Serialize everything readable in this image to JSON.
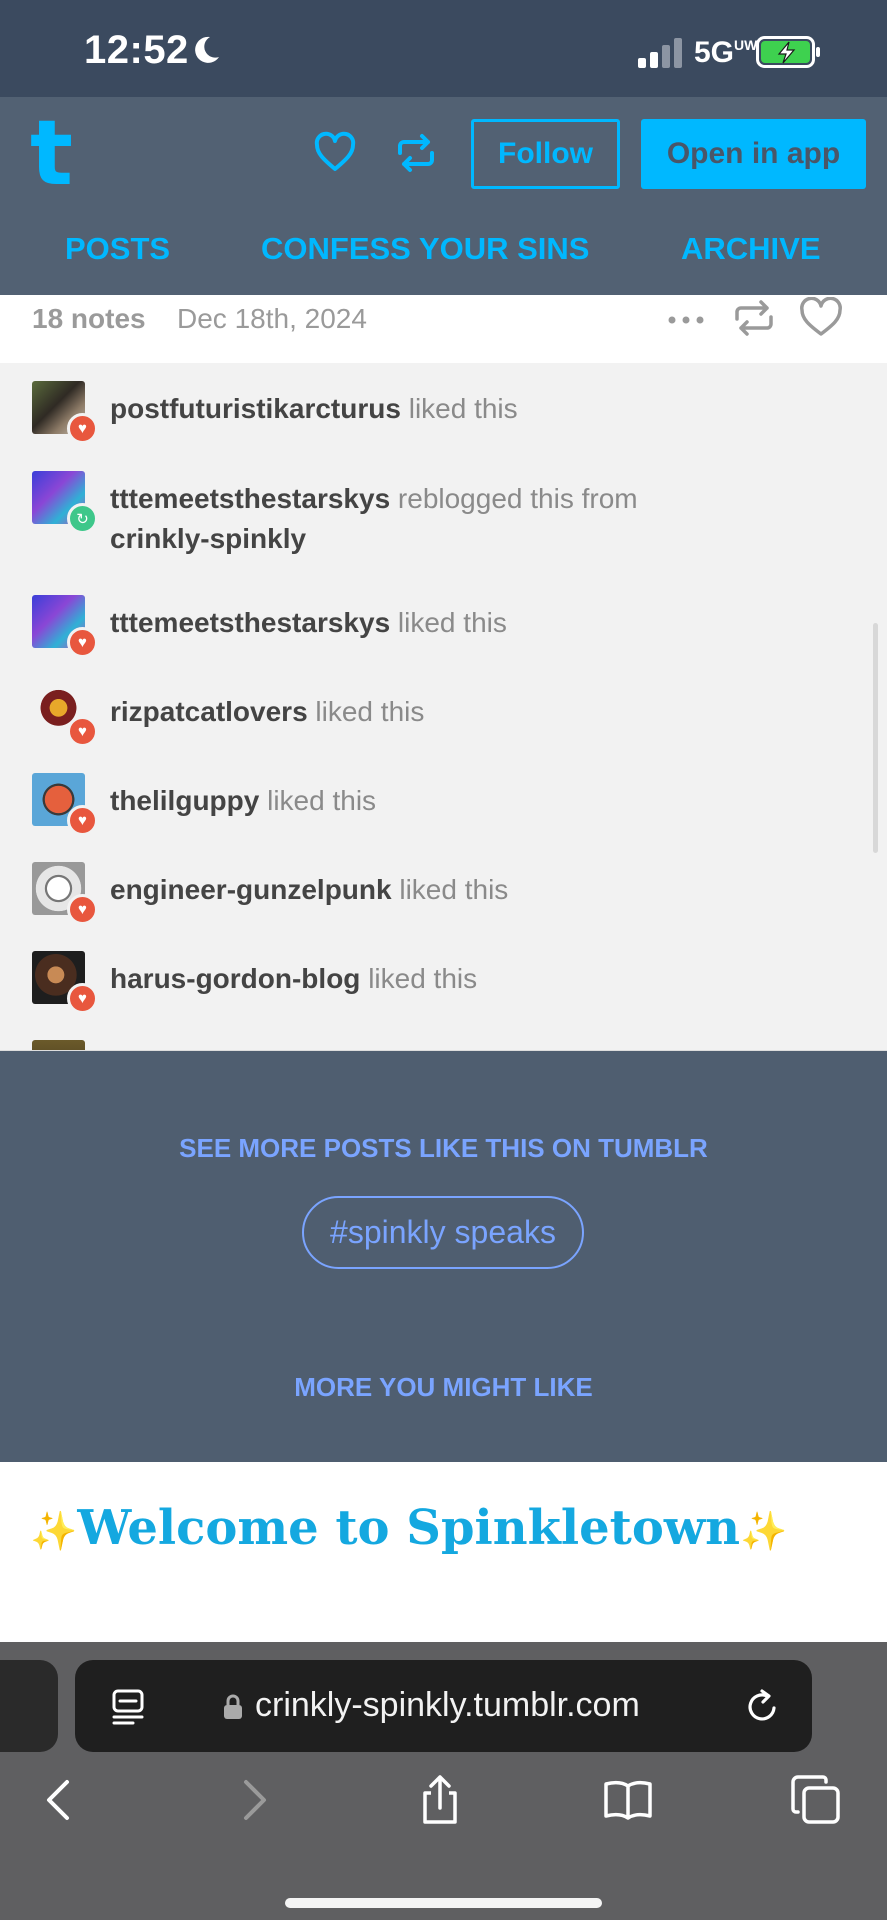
{
  "status_bar": {
    "time": "12:52",
    "network": "5G",
    "network_suffix": "UW"
  },
  "header": {
    "logo": "t",
    "follow_label": "Follow",
    "open_app_label": "Open in app",
    "tabs": [
      "POSTS",
      "CONFESS YOUR SINS",
      "ARCHIVE"
    ]
  },
  "post_meta": {
    "notes": "18 notes",
    "date": "Dec 18th, 2024"
  },
  "notes": [
    {
      "user": "postfuturistikarcturus",
      "action": "liked this",
      "type": "like"
    },
    {
      "user": "tttemeetsthestarskys",
      "action": "reblogged this from",
      "from": "crinkly-spinkly",
      "type": "reblog"
    },
    {
      "user": "tttemeetsthestarskys",
      "action": "liked this",
      "type": "like"
    },
    {
      "user": "rizpatcatlovers",
      "action": "liked this",
      "type": "like"
    },
    {
      "user": "thelilguppy",
      "action": "liked this",
      "type": "like"
    },
    {
      "user": "engineer-gunzelpunk",
      "action": "liked this",
      "type": "like"
    },
    {
      "user": "harus-gordon-blog",
      "action": "liked this",
      "type": "like"
    }
  ],
  "see_more": {
    "heading": "SEE MORE POSTS LIKE THIS ON TUMBLR",
    "tag": "#spinkly speaks"
  },
  "more_like": "MORE YOU MIGHT LIKE",
  "welcome": {
    "title": "Welcome to Spinkletown",
    "sparkle": "✨"
  },
  "browser": {
    "url": "crinkly-spinkly.tumblr.com"
  },
  "colors": {
    "accent": "#00b8ff",
    "header_bg": "#526173",
    "like": "#e8573e",
    "reblog": "#3ec78a",
    "link": "#7aa4ff"
  }
}
